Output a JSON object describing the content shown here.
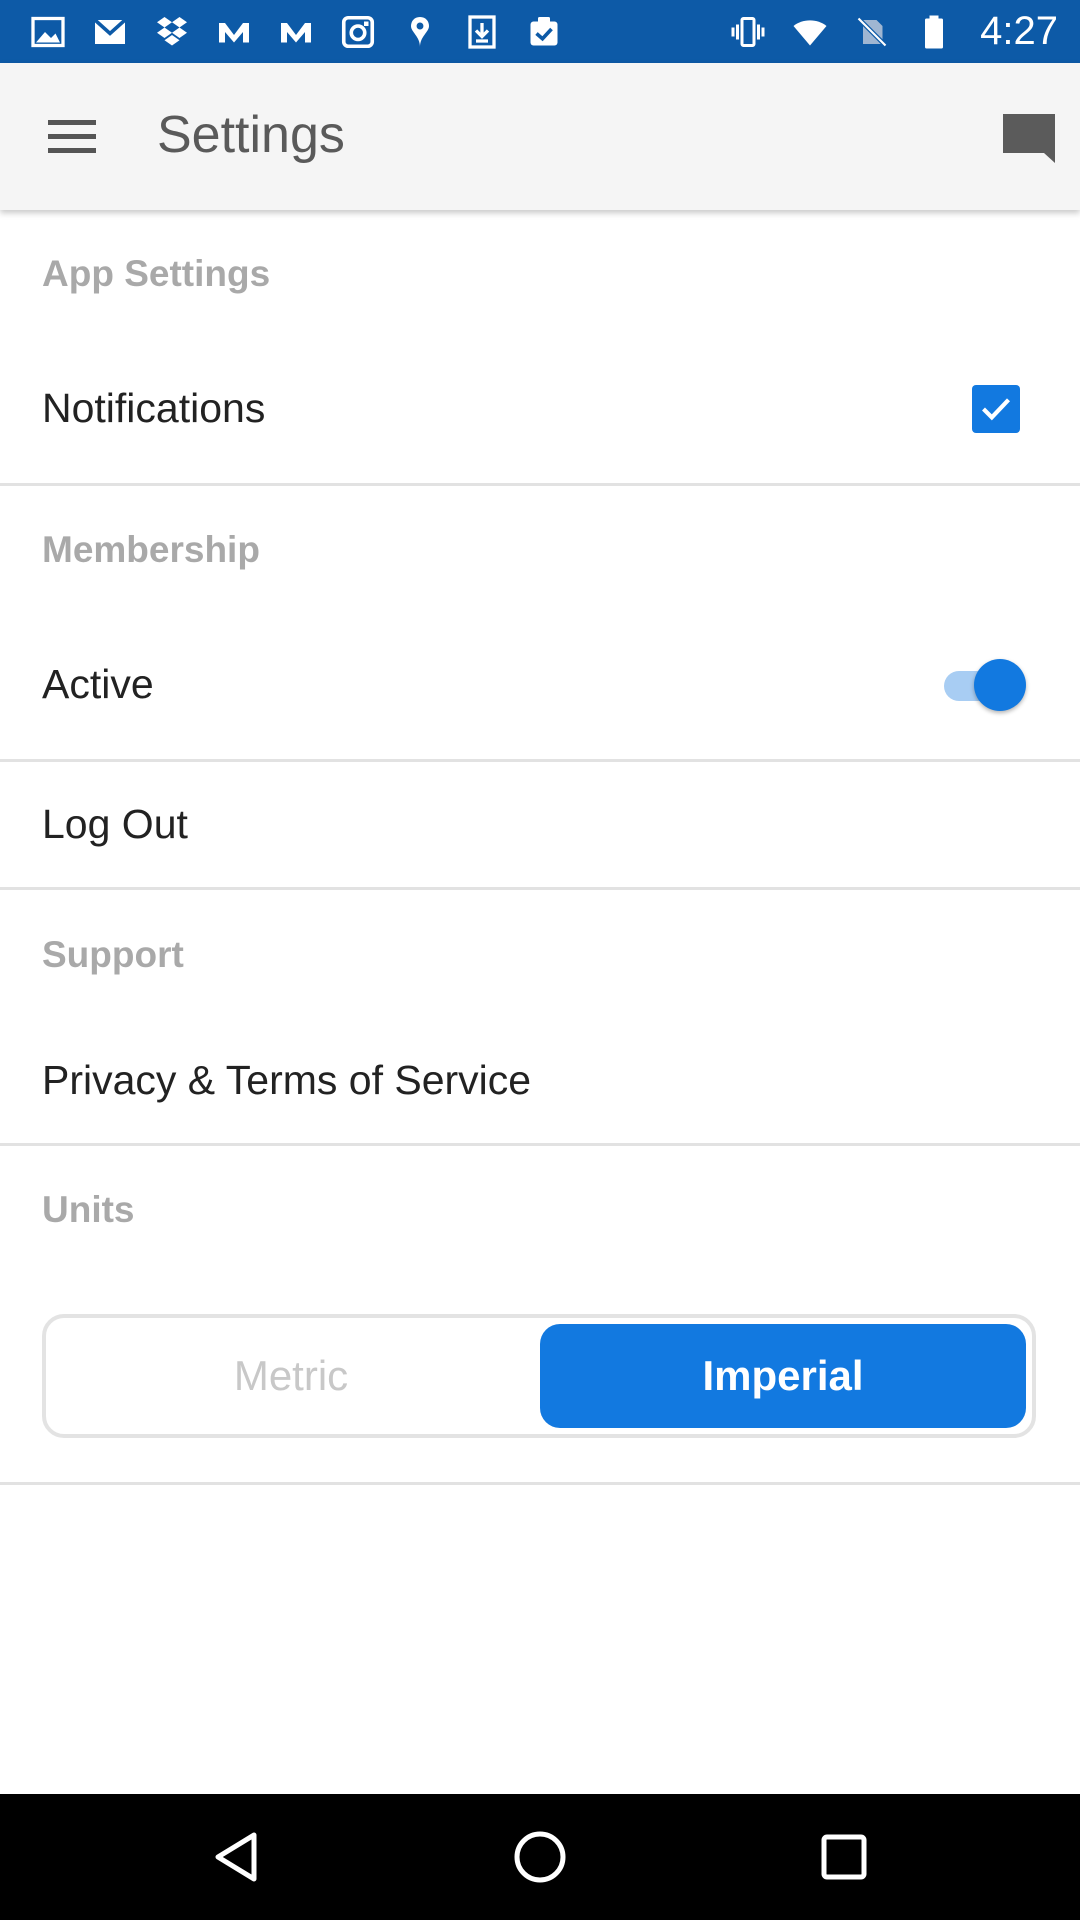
{
  "status_bar": {
    "time": "4:27",
    "left_icons": [
      "image-icon",
      "gmail-icon",
      "dropbox-icon",
      "mapmyfitness-icon",
      "mapmyrun-icon",
      "instagram-icon",
      "location-pin-icon",
      "download-icon",
      "clipboard-check-icon"
    ],
    "right_icons": [
      "vibrate-icon",
      "wifi-icon",
      "no-sim-icon",
      "battery-icon"
    ]
  },
  "app_bar": {
    "title": "Settings",
    "menu_icon": "hamburger-menu-icon",
    "action_icon": "chat-bubble-icon"
  },
  "sections": {
    "app_settings": {
      "header": "App Settings",
      "notifications_label": "Notifications",
      "notifications_checked": true
    },
    "membership": {
      "header": "Membership",
      "active_label": "Active",
      "active_on": true,
      "logout_label": "Log Out"
    },
    "support": {
      "header": "Support",
      "privacy_label": "Privacy & Terms of Service"
    },
    "units": {
      "header": "Units",
      "options": [
        "Metric",
        "Imperial"
      ],
      "selected": "Imperial"
    }
  },
  "colors": {
    "status_bar": "#0d5aa7",
    "accent": "#1279e0",
    "section_header": "#a9a9a9"
  }
}
